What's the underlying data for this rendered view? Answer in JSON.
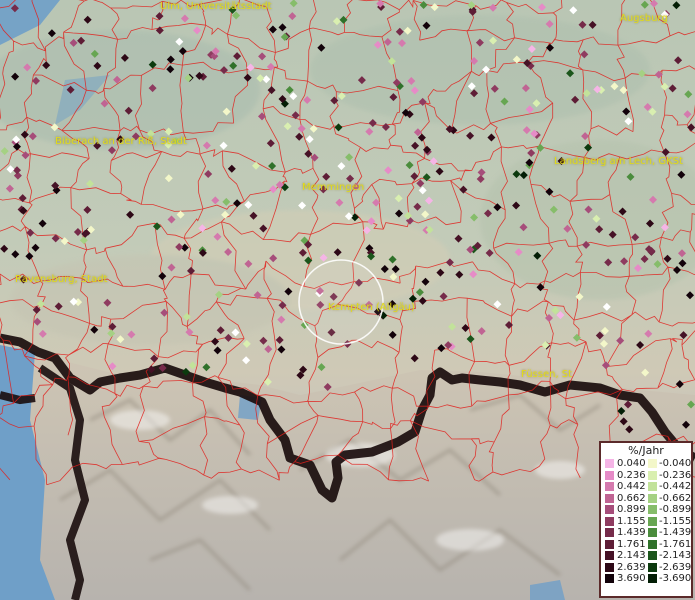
{
  "map": {
    "cities": [
      {
        "label": "Ulm, Universitätsstadt"
      },
      {
        "label": "Augsburg"
      },
      {
        "label": "Biberach an der Riß, Stadt"
      },
      {
        "label": "Landsberg am Lech, GKSt"
      },
      {
        "label": "Memmingen"
      },
      {
        "label": "Ravensburg, Stadt"
      },
      {
        "label": "Kempten (Allgäu)"
      },
      {
        "label": "Füssen, St"
      }
    ],
    "colors": {
      "boundary": "#e0201c",
      "border": "#1a0d0d",
      "lake": "#6f9fc8"
    }
  },
  "legend": {
    "title": "%/Jahr",
    "positive": [
      {
        "value": "0.040",
        "color": "#f5b5e6"
      },
      {
        "value": "0.236",
        "color": "#e68bc7"
      },
      {
        "value": "0.442",
        "color": "#d57aae"
      },
      {
        "value": "0.662",
        "color": "#c06493"
      },
      {
        "value": "0.899",
        "color": "#a64d7a"
      },
      {
        "value": "1.155",
        "color": "#8f3b60"
      },
      {
        "value": "1.439",
        "color": "#762b4a"
      },
      {
        "value": "1.761",
        "color": "#5e1d36"
      },
      {
        "value": "2.143",
        "color": "#461226"
      },
      {
        "value": "2.639",
        "color": "#2d0816"
      },
      {
        "value": "3.690",
        "color": "#12020a"
      }
    ],
    "negative": [
      {
        "value": "-0.040",
        "color": "#f3f7c9"
      },
      {
        "value": "-0.236",
        "color": "#d9efb0"
      },
      {
        "value": "-0.442",
        "color": "#c2e29a"
      },
      {
        "value": "-0.662",
        "color": "#a5d183"
      },
      {
        "value": "-0.899",
        "color": "#86bd6a"
      },
      {
        "value": "-1.155",
        "color": "#67a652"
      },
      {
        "value": "-1.439",
        "color": "#4a8c3c"
      },
      {
        "value": "-1.761",
        "color": "#2f712a"
      },
      {
        "value": "-2.143",
        "color": "#1b551b"
      },
      {
        "value": "-2.639",
        "color": "#0c3a0e"
      },
      {
        "value": "-3.690",
        "color": "#031e05"
      }
    ]
  }
}
